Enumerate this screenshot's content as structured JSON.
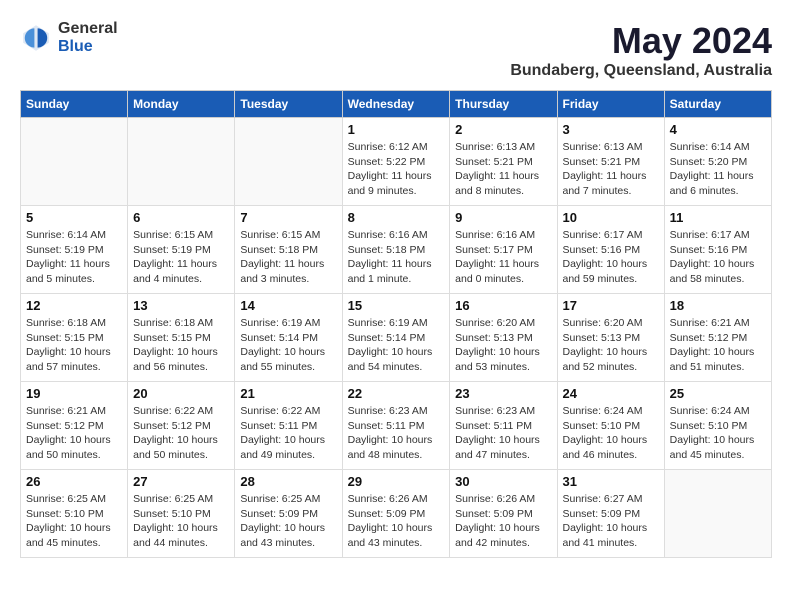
{
  "header": {
    "logo_general": "General",
    "logo_blue": "Blue",
    "month_title": "May 2024",
    "location": "Bundaberg, Queensland, Australia"
  },
  "days_of_week": [
    "Sunday",
    "Monday",
    "Tuesday",
    "Wednesday",
    "Thursday",
    "Friday",
    "Saturday"
  ],
  "weeks": [
    [
      {
        "day": "",
        "info": ""
      },
      {
        "day": "",
        "info": ""
      },
      {
        "day": "",
        "info": ""
      },
      {
        "day": "1",
        "info": "Sunrise: 6:12 AM\nSunset: 5:22 PM\nDaylight: 11 hours\nand 9 minutes."
      },
      {
        "day": "2",
        "info": "Sunrise: 6:13 AM\nSunset: 5:21 PM\nDaylight: 11 hours\nand 8 minutes."
      },
      {
        "day": "3",
        "info": "Sunrise: 6:13 AM\nSunset: 5:21 PM\nDaylight: 11 hours\nand 7 minutes."
      },
      {
        "day": "4",
        "info": "Sunrise: 6:14 AM\nSunset: 5:20 PM\nDaylight: 11 hours\nand 6 minutes."
      }
    ],
    [
      {
        "day": "5",
        "info": "Sunrise: 6:14 AM\nSunset: 5:19 PM\nDaylight: 11 hours\nand 5 minutes."
      },
      {
        "day": "6",
        "info": "Sunrise: 6:15 AM\nSunset: 5:19 PM\nDaylight: 11 hours\nand 4 minutes."
      },
      {
        "day": "7",
        "info": "Sunrise: 6:15 AM\nSunset: 5:18 PM\nDaylight: 11 hours\nand 3 minutes."
      },
      {
        "day": "8",
        "info": "Sunrise: 6:16 AM\nSunset: 5:18 PM\nDaylight: 11 hours\nand 1 minute."
      },
      {
        "day": "9",
        "info": "Sunrise: 6:16 AM\nSunset: 5:17 PM\nDaylight: 11 hours\nand 0 minutes."
      },
      {
        "day": "10",
        "info": "Sunrise: 6:17 AM\nSunset: 5:16 PM\nDaylight: 10 hours\nand 59 minutes."
      },
      {
        "day": "11",
        "info": "Sunrise: 6:17 AM\nSunset: 5:16 PM\nDaylight: 10 hours\nand 58 minutes."
      }
    ],
    [
      {
        "day": "12",
        "info": "Sunrise: 6:18 AM\nSunset: 5:15 PM\nDaylight: 10 hours\nand 57 minutes."
      },
      {
        "day": "13",
        "info": "Sunrise: 6:18 AM\nSunset: 5:15 PM\nDaylight: 10 hours\nand 56 minutes."
      },
      {
        "day": "14",
        "info": "Sunrise: 6:19 AM\nSunset: 5:14 PM\nDaylight: 10 hours\nand 55 minutes."
      },
      {
        "day": "15",
        "info": "Sunrise: 6:19 AM\nSunset: 5:14 PM\nDaylight: 10 hours\nand 54 minutes."
      },
      {
        "day": "16",
        "info": "Sunrise: 6:20 AM\nSunset: 5:13 PM\nDaylight: 10 hours\nand 53 minutes."
      },
      {
        "day": "17",
        "info": "Sunrise: 6:20 AM\nSunset: 5:13 PM\nDaylight: 10 hours\nand 52 minutes."
      },
      {
        "day": "18",
        "info": "Sunrise: 6:21 AM\nSunset: 5:12 PM\nDaylight: 10 hours\nand 51 minutes."
      }
    ],
    [
      {
        "day": "19",
        "info": "Sunrise: 6:21 AM\nSunset: 5:12 PM\nDaylight: 10 hours\nand 50 minutes."
      },
      {
        "day": "20",
        "info": "Sunrise: 6:22 AM\nSunset: 5:12 PM\nDaylight: 10 hours\nand 50 minutes."
      },
      {
        "day": "21",
        "info": "Sunrise: 6:22 AM\nSunset: 5:11 PM\nDaylight: 10 hours\nand 49 minutes."
      },
      {
        "day": "22",
        "info": "Sunrise: 6:23 AM\nSunset: 5:11 PM\nDaylight: 10 hours\nand 48 minutes."
      },
      {
        "day": "23",
        "info": "Sunrise: 6:23 AM\nSunset: 5:11 PM\nDaylight: 10 hours\nand 47 minutes."
      },
      {
        "day": "24",
        "info": "Sunrise: 6:24 AM\nSunset: 5:10 PM\nDaylight: 10 hours\nand 46 minutes."
      },
      {
        "day": "25",
        "info": "Sunrise: 6:24 AM\nSunset: 5:10 PM\nDaylight: 10 hours\nand 45 minutes."
      }
    ],
    [
      {
        "day": "26",
        "info": "Sunrise: 6:25 AM\nSunset: 5:10 PM\nDaylight: 10 hours\nand 45 minutes."
      },
      {
        "day": "27",
        "info": "Sunrise: 6:25 AM\nSunset: 5:10 PM\nDaylight: 10 hours\nand 44 minutes."
      },
      {
        "day": "28",
        "info": "Sunrise: 6:25 AM\nSunset: 5:09 PM\nDaylight: 10 hours\nand 43 minutes."
      },
      {
        "day": "29",
        "info": "Sunrise: 6:26 AM\nSunset: 5:09 PM\nDaylight: 10 hours\nand 43 minutes."
      },
      {
        "day": "30",
        "info": "Sunrise: 6:26 AM\nSunset: 5:09 PM\nDaylight: 10 hours\nand 42 minutes."
      },
      {
        "day": "31",
        "info": "Sunrise: 6:27 AM\nSunset: 5:09 PM\nDaylight: 10 hours\nand 41 minutes."
      },
      {
        "day": "",
        "info": ""
      }
    ]
  ]
}
